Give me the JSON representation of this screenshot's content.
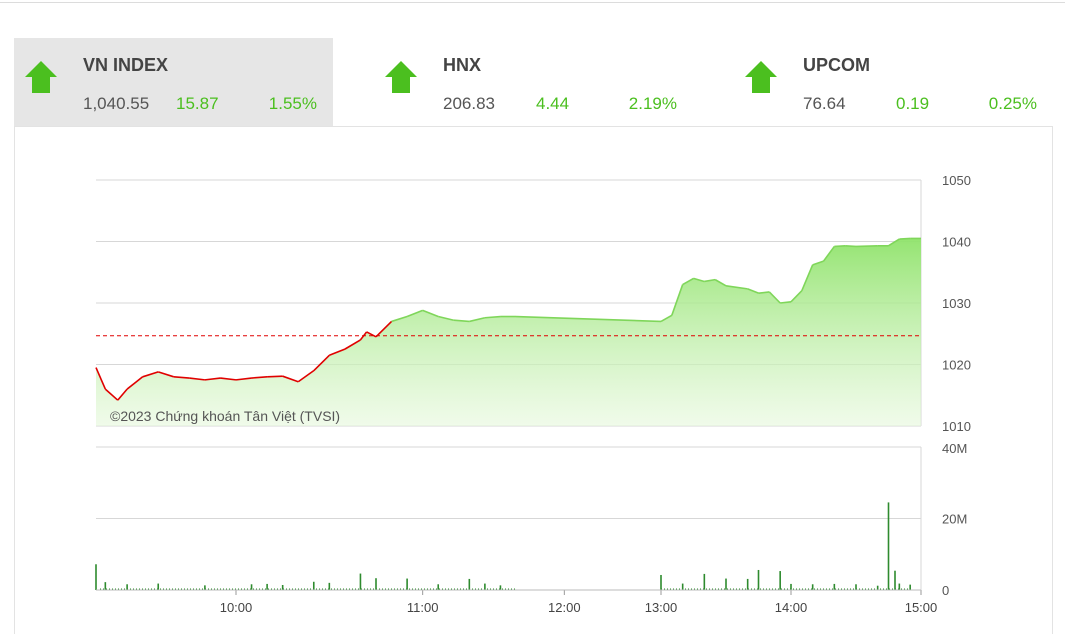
{
  "indices": [
    {
      "name": "VN INDEX",
      "value": "1,040.55",
      "change": "15.87",
      "percent": "1.55%",
      "direction": "up",
      "active": true
    },
    {
      "name": "HNX",
      "value": "206.83",
      "change": "4.44",
      "percent": "2.19%",
      "direction": "up",
      "active": false
    },
    {
      "name": "UPCOM",
      "value": "76.64",
      "change": "0.19",
      "percent": "0.25%",
      "direction": "up",
      "active": false
    }
  ],
  "colors": {
    "up": "#4bbf1f",
    "down": "#e00000",
    "reference": "#e00000",
    "volume": "#2e8b2e"
  },
  "chart_data": [
    {
      "type": "line",
      "title": "",
      "watermark": "©2023 Chứng khoán Tân Việt (TVSI)",
      "reference": 1024.68,
      "ylim": [
        1010,
        1050
      ],
      "yticks": [
        "1050",
        "1040",
        "1030",
        "1020",
        "1010"
      ],
      "xticks": [
        "10:00",
        "11:00",
        "12:00",
        "13:00",
        "14:00",
        "15:00"
      ],
      "x": [
        "09:15",
        "09:18",
        "09:22",
        "09:25",
        "09:30",
        "09:35",
        "09:40",
        "09:45",
        "09:50",
        "09:55",
        "10:00",
        "10:05",
        "10:10",
        "10:15",
        "10:20",
        "10:25",
        "10:30",
        "10:35",
        "10:40",
        "10:42",
        "10:45",
        "10:50",
        "10:55",
        "11:00",
        "11:05",
        "11:10",
        "11:15",
        "11:20",
        "11:25",
        "11:30",
        "13:00",
        "13:05",
        "13:10",
        "13:15",
        "13:20",
        "13:25",
        "13:30",
        "13:40",
        "13:45",
        "13:50",
        "13:55",
        "14:00",
        "14:05",
        "14:10",
        "14:15",
        "14:20",
        "14:25",
        "14:30",
        "14:40",
        "14:45",
        "14:50",
        "14:55",
        "15:00"
      ],
      "values": [
        1019.5,
        1016,
        1014.2,
        1016,
        1018,
        1018.8,
        1018,
        1017.8,
        1017.5,
        1017.8,
        1017.5,
        1017.8,
        1018,
        1018.1,
        1017.2,
        1019,
        1021.5,
        1022.5,
        1024,
        1025.3,
        1024.5,
        1027,
        1027.8,
        1028.8,
        1027.8,
        1027.2,
        1027,
        1027.6,
        1027.8,
        1027.8,
        1027,
        1028,
        1033,
        1034,
        1033.5,
        1033.8,
        1032.8,
        1032.3,
        1031.6,
        1031.8,
        1030,
        1030.2,
        1032,
        1036.2,
        1036.8,
        1039.2,
        1039.3,
        1039.2,
        1039.3,
        1039.3,
        1040.4,
        1040.5,
        1040.5
      ]
    },
    {
      "type": "bar",
      "title": "",
      "ylim": [
        0,
        40
      ],
      "yunit": "M",
      "yticks": [
        "40M",
        "20M",
        "0"
      ],
      "xticks": [
        "10:00",
        "11:00",
        "12:00",
        "13:00",
        "14:00",
        "15:00"
      ],
      "x": [
        "09:15",
        "09:18",
        "09:25",
        "09:35",
        "09:50",
        "10:05",
        "10:10",
        "10:15",
        "10:25",
        "10:30",
        "10:40",
        "10:45",
        "10:55",
        "11:05",
        "11:15",
        "11:20",
        "11:25",
        "13:00",
        "13:10",
        "13:20",
        "13:30",
        "13:40",
        "13:45",
        "13:55",
        "14:00",
        "14:10",
        "14:20",
        "14:30",
        "14:40",
        "14:45",
        "14:48",
        "14:50",
        "14:55"
      ],
      "values": [
        7.2,
        2.2,
        1.6,
        1.8,
        1.3,
        1.6,
        1.7,
        1.4,
        2.3,
        2,
        4.6,
        3.3,
        3.2,
        1.6,
        3.1,
        1.8,
        1.3,
        4.2,
        1.8,
        4.5,
        3.2,
        3.1,
        5.6,
        5.3,
        1.7,
        1.6,
        1.7,
        1.6,
        1.2,
        24.5,
        5.4,
        1.8,
        1.5
      ]
    }
  ]
}
